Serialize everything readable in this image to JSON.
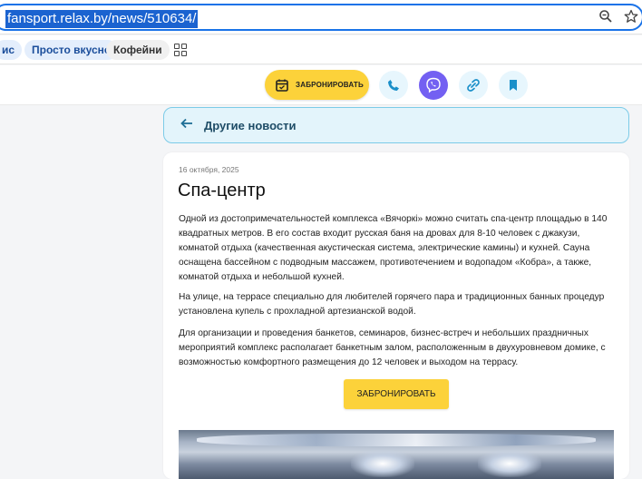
{
  "browser": {
    "url": "fansport.relax.by/news/510634/"
  },
  "bookmarks": {
    "items": [
      {
        "label": "ис"
      },
      {
        "label": "Просто вкусно"
      },
      {
        "label": "Кофейни"
      }
    ]
  },
  "toolbar": {
    "book_label": "ЗАБРОНИРОВАТЬ",
    "accent_yellow": "#fcd23a",
    "viber_color": "#7360f2"
  },
  "nav": {
    "back_label": "Другие новости"
  },
  "article": {
    "date": "16 октября, 2025",
    "title": "Спа-центр",
    "paragraphs": [
      "Одной из достопримечательностей комплекса «Вячоркі» можно считать спа-центр площадью в 140 квадратных метров. В его состав входит русская баня на дровах для 8-10 человек с джакузи, комнатой отдыха (качественная акустическая система, электрические камины) и кухней. Сауна оснащена бассейном с подводным массажем, противотечением и водопадом «Кобра», а также, комнатой отдыха и небольшой кухней.",
      "На улице, на террасе специально для любителей горячего пара и традиционных банных процедур установлена купель с прохладной артезианской водой.",
      "Для организации и проведения банкетов, семинаров, бизнес-встреч и небольших праздничных мероприятий комплекс располагает банкетным залом, расположенным в двухуровневом домике, с возможностью комфортного размещения до 12 человек и выходом на террасу."
    ],
    "cta_label": "ЗАБРОНИРОВАТЬ"
  }
}
